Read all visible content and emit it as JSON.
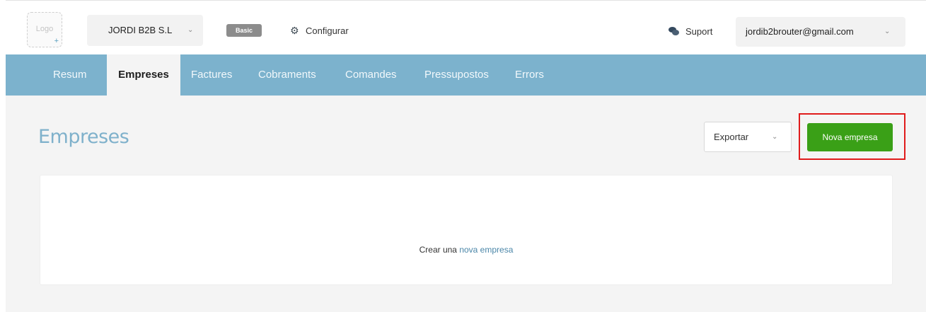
{
  "header": {
    "logo_text": "Logo",
    "logo_plus": "+",
    "company": "JORDI B2B S.L",
    "plan_badge": "Basic",
    "configure_label": "Configurar",
    "support_label": "Suport",
    "user_email": "jordib2brouter@gmail.com"
  },
  "nav": {
    "items": [
      {
        "label": "Resum"
      },
      {
        "label": "Empreses"
      },
      {
        "label": "Factures"
      },
      {
        "label": "Cobraments"
      },
      {
        "label": "Comandes"
      },
      {
        "label": "Pressupostos"
      },
      {
        "label": "Errors"
      }
    ],
    "active": "Empreses"
  },
  "main": {
    "title": "Empreses",
    "export_label": "Exportar",
    "new_button_label": "Nova empresa",
    "empty_prefix": "Crear una",
    "empty_link": "nova empresa"
  },
  "icons": {
    "chevron": "chevron-down-icon",
    "gear": "gear-icon",
    "chat": "chat-icon"
  },
  "colors": {
    "nav_bg": "#7cb2cd",
    "primary_button": "#3aa017",
    "highlight": "#e01b1b",
    "title": "#7fb1cb",
    "link": "#4a86a8"
  }
}
